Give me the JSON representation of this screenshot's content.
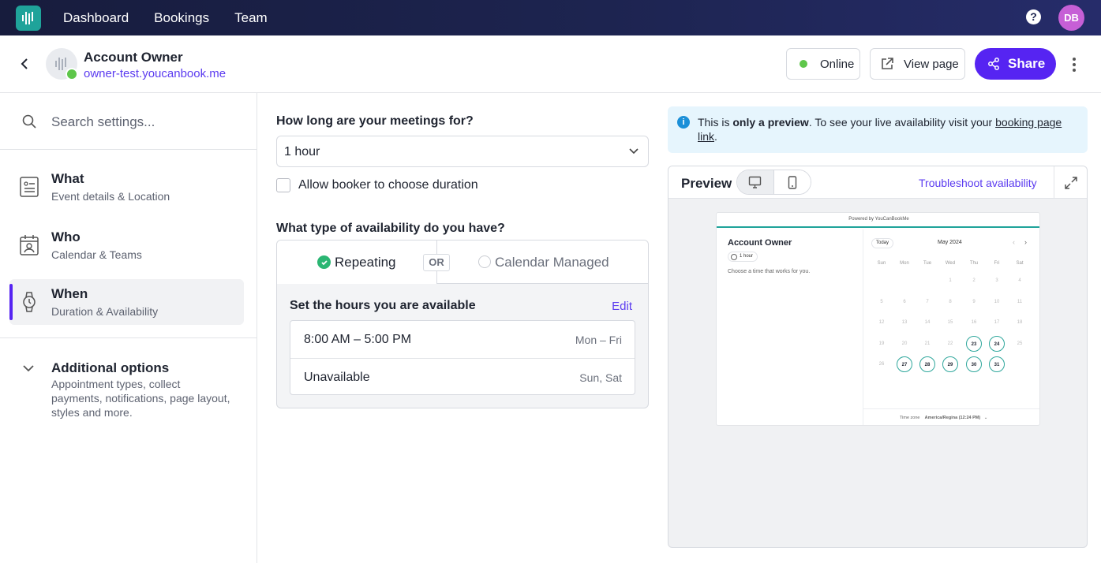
{
  "nav": {
    "links": [
      "Dashboard",
      "Bookings",
      "Team"
    ],
    "help_icon": "?",
    "avatar_initials": "DB"
  },
  "header": {
    "title": "Account Owner",
    "url": "owner-test.youcanbook.me",
    "status_label": "Online",
    "view_page_label": "View page",
    "share_label": "Share",
    "status_color": "#5ec64a",
    "accent_color": "#5624f2"
  },
  "sidebar": {
    "search_placeholder": "Search settings...",
    "items": [
      {
        "title": "What",
        "subtitle": "Event details & Location",
        "icon": "document-icon"
      },
      {
        "title": "Who",
        "subtitle": "Calendar & Teams",
        "icon": "calendar-person-icon"
      },
      {
        "title": "When",
        "subtitle": "Duration & Availability",
        "icon": "watch-icon"
      }
    ],
    "additional": {
      "title": "Additional options",
      "subtitle": "Appointment types, collect payments, notifications, page layout, styles and more."
    }
  },
  "main": {
    "duration_question": "How long are your meetings for?",
    "duration_value": "1 hour",
    "allow_choose_label": "Allow booker to choose duration",
    "availability_question": "What type of availability do you have?",
    "tab_repeating": "Repeating",
    "or_label": "OR",
    "tab_calendar_managed": "Calendar Managed",
    "set_hours_title": "Set the hours you are available",
    "edit_label": "Edit",
    "hours": [
      {
        "time": "8:00 AM – 5:00 PM",
        "days": "Mon – Fri"
      },
      {
        "time": "Unavailable",
        "days": "Sun, Sat"
      }
    ]
  },
  "notice": {
    "text_before": "This is ",
    "bold": "only a preview",
    "text_mid": ". To see your live availability visit your ",
    "link": "booking page link",
    "text_after": "."
  },
  "preview": {
    "title": "Preview",
    "troubleshoot_label": "Troubleshoot availability",
    "mini": {
      "powered_by": "Powered by YouCanBookMe",
      "name": "Account Owner",
      "duration": "1 hour",
      "choose_text": "Choose a time that works for you.",
      "today_label": "Today",
      "month_label": "May 2024",
      "weekdays": [
        "Sun",
        "Mon",
        "Tue",
        "Wed",
        "Thu",
        "Fri",
        "Sat"
      ],
      "first_weekday_index": 3,
      "days_in_month": 31,
      "available_days": [
        23,
        24,
        27,
        28,
        29,
        30,
        31
      ],
      "timezone_label": "Time zone",
      "timezone_value": "America/Regina (12:24 PM)"
    }
  }
}
